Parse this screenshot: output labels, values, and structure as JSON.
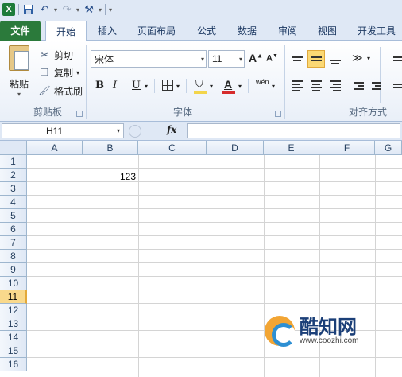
{
  "quick_access": {
    "excel_icon": "excel-icon",
    "save_icon": "save-icon",
    "undo_icon": "undo-icon",
    "redo_icon": "redo-icon",
    "customize_icon": "customize-qat-icon"
  },
  "tabs": {
    "file": "文件",
    "home": "开始",
    "insert": "插入",
    "page_layout": "页面布局",
    "formulas": "公式",
    "data": "数据",
    "review": "审阅",
    "view": "视图",
    "developer": "开发工具"
  },
  "clipboard": {
    "paste": "粘贴",
    "cut": "剪切",
    "copy": "复制",
    "format_painter": "格式刷",
    "group_label": "剪贴板"
  },
  "font": {
    "name": "宋体",
    "size": "11",
    "bold": "B",
    "italic": "I",
    "underline": "U",
    "font_color_label": "A",
    "phonetic": "wén",
    "group_label": "字体",
    "font_color": "#d62c2c",
    "fill_color": "#f3d54b"
  },
  "alignment": {
    "group_label": "对齐方式"
  },
  "formula_bar": {
    "name_box": "H11",
    "fx": "fx",
    "content": ""
  },
  "sheet": {
    "columns": [
      "A",
      "B",
      "C",
      "D",
      "E",
      "F",
      "G"
    ],
    "rows": [
      "1",
      "2",
      "3",
      "4",
      "5",
      "6",
      "7",
      "8",
      "9",
      "10",
      "11",
      "12",
      "13",
      "14",
      "15",
      "16"
    ],
    "selected_row": "11",
    "cells": {
      "B2": "123"
    }
  },
  "watermark": {
    "brand": "酷知网",
    "url": "www.coozhi.com"
  }
}
